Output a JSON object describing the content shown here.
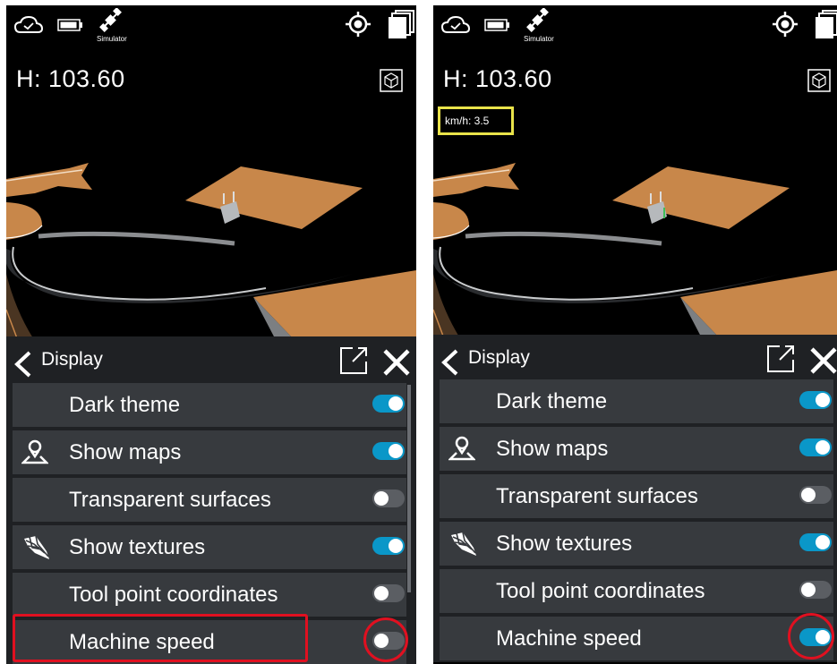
{
  "left_panel": {
    "simulator_label": "Simulator",
    "height_readout": "H: 103.60",
    "settings": {
      "title": "Display",
      "rows": [
        {
          "label": "Dark theme",
          "icon": "",
          "on": true
        },
        {
          "label": "Show maps",
          "icon": "map-pin-icon",
          "on": true
        },
        {
          "label": "Transparent surfaces",
          "icon": "",
          "on": false
        },
        {
          "label": "Show textures",
          "icon": "texture-mesh-icon",
          "on": true
        },
        {
          "label": "Tool point coordinates",
          "icon": "",
          "on": false
        },
        {
          "label": "Machine speed",
          "icon": "",
          "on": false
        }
      ]
    }
  },
  "right_panel": {
    "simulator_label": "Simulator",
    "height_readout": "H: 103.60",
    "speed_readout": "km/h: 3.5",
    "settings": {
      "title": "Display",
      "rows": [
        {
          "label": "Dark theme",
          "icon": "",
          "on": true
        },
        {
          "label": "Show maps",
          "icon": "map-pin-icon",
          "on": true
        },
        {
          "label": "Transparent surfaces",
          "icon": "",
          "on": false
        },
        {
          "label": "Show textures",
          "icon": "texture-mesh-icon",
          "on": true
        },
        {
          "label": "Tool point coordinates",
          "icon": "",
          "on": false
        },
        {
          "label": "Machine speed",
          "icon": "",
          "on": true
        }
      ]
    }
  },
  "colors": {
    "toggle_on": "#0a97c8",
    "toggle_off": "#5b5e63",
    "highlight_red": "#e01020",
    "highlight_yellow": "#e9e34a",
    "terrain": "#c8874a"
  }
}
